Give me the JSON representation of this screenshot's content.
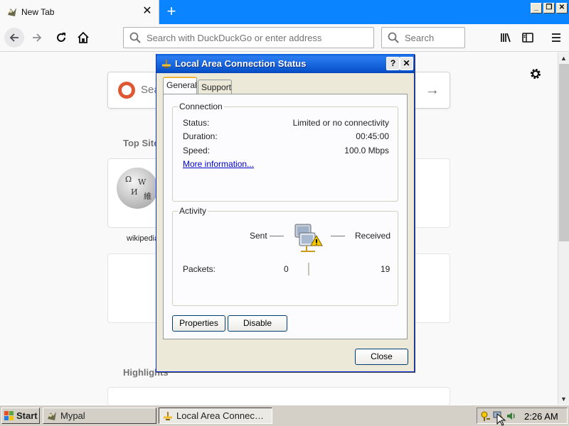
{
  "browser": {
    "tab_title": "New Tab",
    "new_tab_symbol": "+",
    "close_tab_symbol": "✕",
    "url_placeholder": "Search with DuckDuckGo or enter address",
    "search_placeholder": "Search",
    "window_buttons": [
      "_",
      "❐",
      "✕"
    ]
  },
  "newtab_page": {
    "search_placeholder": "Search the Web",
    "top_sites_title": "Top Sites",
    "top_sites": [
      {
        "label": "wikipedia",
        "icon": "wikipedia-globe-icon"
      }
    ],
    "highlights_title": "Highlights"
  },
  "dialog": {
    "title": "Local Area Connection Status",
    "help_symbol": "?",
    "close_symbol": "✕",
    "tabs": [
      "General",
      "Support"
    ],
    "active_tab": "General",
    "connection": {
      "legend": "Connection",
      "rows": [
        {
          "label": "Status:",
          "value": "Limited or no connectivity"
        },
        {
          "label": "Duration:",
          "value": "00:45:00"
        },
        {
          "label": "Speed:",
          "value": "100.0 Mbps"
        }
      ],
      "more_info": "More information..."
    },
    "activity": {
      "legend": "Activity",
      "sent_label": "Sent",
      "received_label": "Received",
      "packets_label": "Packets:",
      "packets_sent": "0",
      "packets_received": "19"
    },
    "buttons": {
      "properties": "Properties",
      "disable": "Disable",
      "close": "Close"
    }
  },
  "taskbar": {
    "start_label": "Start",
    "items": [
      {
        "label": "Mypal",
        "active": false
      },
      {
        "label": "Local Area Connec…",
        "active": true
      }
    ],
    "clock": "2:26 AM"
  },
  "colors": {
    "titlebar_blue": "#0b56d0",
    "firefox_blue": "#0a84ff",
    "dialog_bg": "#ece9d8",
    "link": "#0000cc",
    "warning_yellow": "#f5c800"
  }
}
